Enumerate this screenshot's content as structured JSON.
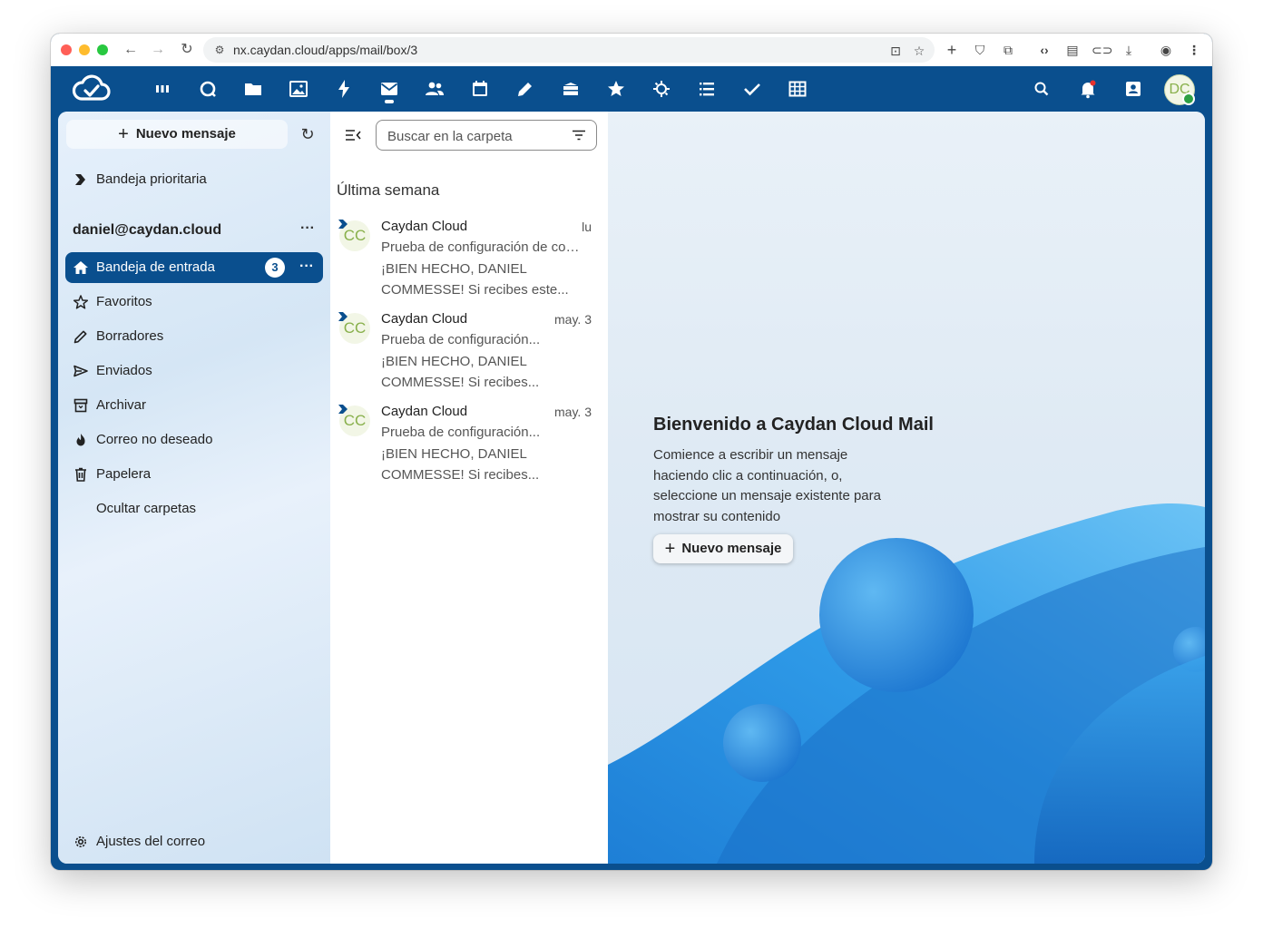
{
  "browser": {
    "url": "nx.caydan.cloud/apps/mail/box/3"
  },
  "header": {
    "user_initials": "DC",
    "apps": [
      "dashboard-icon",
      "talk-icon",
      "files-icon",
      "photos-icon",
      "activity-icon",
      "mail-icon",
      "contacts-icon",
      "calendar-icon",
      "notes-icon",
      "deck-icon",
      "favorites-icon",
      "spreed-icon",
      "tasks-icon",
      "checks-icon",
      "tables-icon"
    ]
  },
  "sidebar": {
    "new_message_label": "Nuevo mensaje",
    "priority_inbox": "Bandeja prioritaria",
    "account": "daniel@caydan.cloud",
    "account_menu": "···",
    "folders": [
      {
        "label": "Bandeja de entrada",
        "unread": "3"
      },
      {
        "label": "Favoritos"
      },
      {
        "label": "Borradores"
      },
      {
        "label": "Enviados"
      },
      {
        "label": "Archivar"
      },
      {
        "label": "Correo no deseado"
      },
      {
        "label": "Papelera"
      },
      {
        "label": "Ocultar carpetas"
      }
    ],
    "settings_label": "Ajustes del correo"
  },
  "list": {
    "search_placeholder": "Buscar en la carpeta",
    "group_title": "Última semana",
    "messages": [
      {
        "initials": "CC",
        "from": "Caydan Cloud",
        "date": "lu",
        "subject": "Prueba de configuración de correo",
        "preview": "¡BIEN HECHO, DANIEL COMMESSE! Si recibes este..."
      },
      {
        "initials": "CC",
        "from": "Caydan Cloud",
        "date": "may. 3",
        "subject": "Prueba de configuración...",
        "preview": "¡BIEN HECHO, DANIEL COMMESSE! Si recibes..."
      },
      {
        "initials": "CC",
        "from": "Caydan Cloud",
        "date": "may. 3",
        "subject": "Prueba de configuración...",
        "preview": "¡BIEN HECHO, DANIEL COMMESSE! Si recibes..."
      }
    ]
  },
  "welcome": {
    "title": "Bienvenido a Caydan Cloud Mail",
    "text": "Comience a escribir un mensaje haciendo clic a continuación, o, seleccione un mensaje existente para mostrar su contenido",
    "button_label": "Nuevo mensaje"
  },
  "colors": {
    "brand": "#0a4f8e",
    "avatar_text": "#88b04b"
  }
}
